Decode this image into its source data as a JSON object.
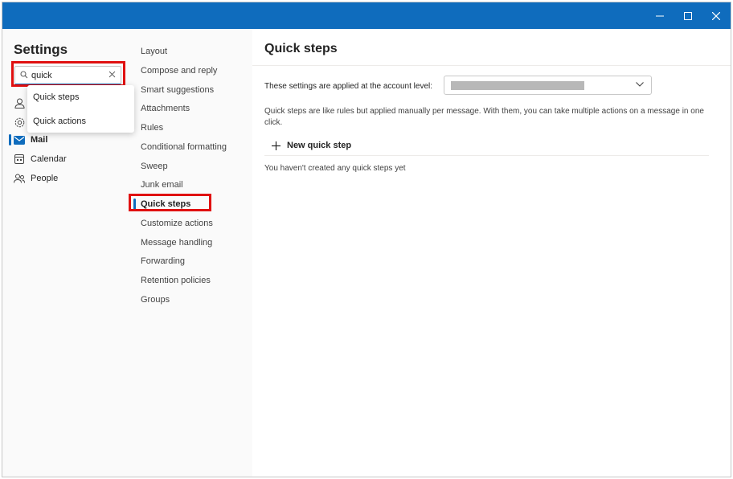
{
  "colors": {
    "accent": "#0f6cbd",
    "highlight": "#e01010",
    "pane_bg": "#fafafa"
  },
  "titlebar": {
    "minimize_icon": "minimize-icon",
    "maximize_icon": "maximize-icon",
    "close_icon": "close-icon"
  },
  "settings": {
    "title": "Settings",
    "search": {
      "value": "quick",
      "placeholder": ""
    },
    "suggestions": [
      "Quick steps",
      "Quick actions"
    ],
    "nav": [
      {
        "label": "Mail",
        "icon": "mail-icon",
        "selected": true
      },
      {
        "label": "Calendar",
        "icon": "calendar-icon",
        "selected": false
      },
      {
        "label": "People",
        "icon": "people-icon",
        "selected": false
      }
    ]
  },
  "mail_nav": {
    "items": [
      "Layout",
      "Compose and reply",
      "Smart suggestions",
      "Attachments",
      "Rules",
      "Conditional formatting",
      "Sweep",
      "Junk email",
      "Quick steps",
      "Customize actions",
      "Message handling",
      "Forwarding",
      "Retention policies",
      "Groups"
    ],
    "selected": "Quick steps"
  },
  "main": {
    "title": "Quick steps",
    "account_label": "These settings are applied at the account level:",
    "description": "Quick steps are like rules but applied manually per message. With them, you can take multiple actions on a message in one click.",
    "new_button": "New quick step",
    "empty_text": "You haven't created any quick steps yet"
  }
}
